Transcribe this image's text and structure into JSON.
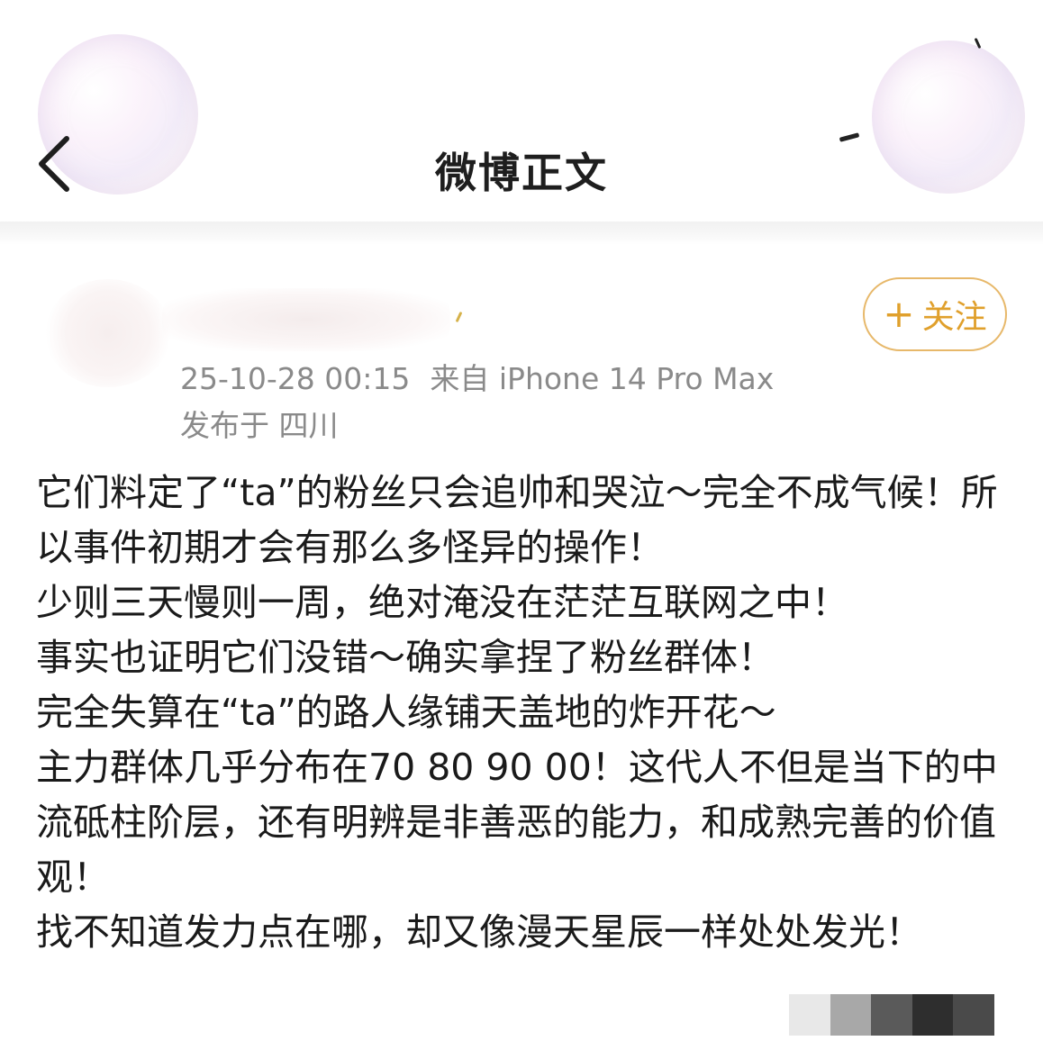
{
  "header": {
    "title": "微博正文"
  },
  "author": {
    "follow_label": "关注",
    "timestamp": "25-10-28 00:15",
    "source": "来自 iPhone 14 Pro Max",
    "location": "发布于 四川"
  },
  "post": {
    "paragraphs": [
      "它们料定了“ta”的粉丝只会追帅和哭泣～完全不成气候！所以事件初期才会有那么多怪异的操作！",
      "少则三天慢则一周，绝对淹没在茫茫互联网之中！",
      "事实也证明它们没错～确实拿捏了粉丝群体！",
      "完全失算在“ta”的路人缘铺天盖地的炸开花～",
      "主力群体几乎分布在70 80 90 00！这代人不但是当下的中流砥柱阶层，还有明辨是非善恶的能力，和成熟完善的价值观！",
      "找不知道发力点在哪，却又像漫天星辰一样处处发光！"
    ]
  },
  "colors": {
    "follow_accent": "#e0a02c",
    "meta_gray": "#8a8a8a",
    "text": "#1a1a1a"
  },
  "icons": {
    "back": "chevron-left-icon",
    "follow": "plus-icon"
  }
}
